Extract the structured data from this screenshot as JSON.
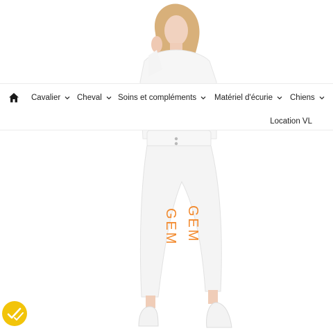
{
  "nav": {
    "home_icon": "home-icon",
    "items": [
      {
        "label": "Cavalier"
      },
      {
        "label": "Cheval"
      },
      {
        "label": "Soins et compléments"
      },
      {
        "label": "Matériel d'écurie"
      },
      {
        "label": "Chiens"
      }
    ],
    "second_row_item": "Location VL"
  },
  "product_image": {
    "print_text": "GEM"
  },
  "review_badge": {
    "icon": "checkmark-badge-icon",
    "color": "#f2c40a"
  }
}
